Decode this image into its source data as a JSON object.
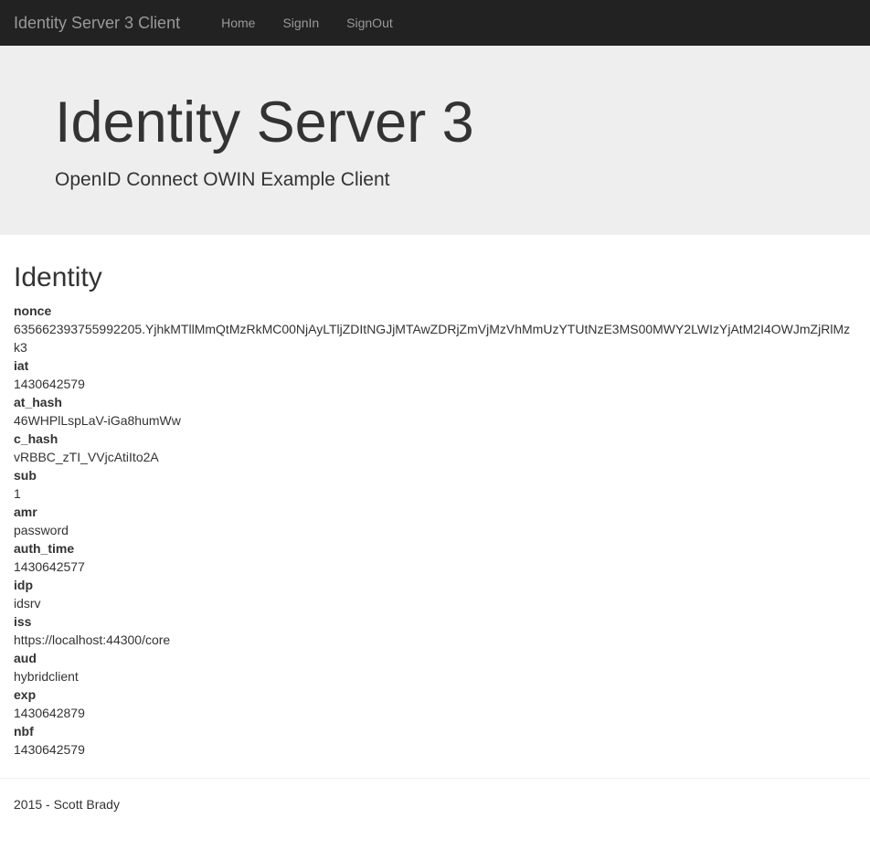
{
  "navbar": {
    "brand": "Identity Server 3 Client",
    "links": [
      {
        "label": "Home"
      },
      {
        "label": "SignIn"
      },
      {
        "label": "SignOut"
      }
    ]
  },
  "jumbotron": {
    "title": "Identity Server 3",
    "subtitle": "OpenID Connect OWIN Example Client"
  },
  "identity": {
    "heading": "Identity",
    "claims": [
      {
        "key": "nonce",
        "value": "635662393755992205.YjhkMTllMmQtMzRkMC00NjAyLTljZDItNGJjMTAwZDRjZmVjMzVhMmUzYTUtNzE3MS00MWY2LWIzYjAtM2I4OWJmZjRlMzk3"
      },
      {
        "key": "iat",
        "value": "1430642579"
      },
      {
        "key": "at_hash",
        "value": "46WHPlLspLaV-iGa8humWw"
      },
      {
        "key": "c_hash",
        "value": "vRBBC_zTI_VVjcAtiIto2A"
      },
      {
        "key": "sub",
        "value": "1"
      },
      {
        "key": "amr",
        "value": "password"
      },
      {
        "key": "auth_time",
        "value": "1430642577"
      },
      {
        "key": "idp",
        "value": "idsrv"
      },
      {
        "key": "iss",
        "value": "https://localhost:44300/core"
      },
      {
        "key": "aud",
        "value": "hybridclient"
      },
      {
        "key": "exp",
        "value": "1430642879"
      },
      {
        "key": "nbf",
        "value": "1430642579"
      }
    ]
  },
  "footer": {
    "text": "2015 - Scott Brady"
  }
}
